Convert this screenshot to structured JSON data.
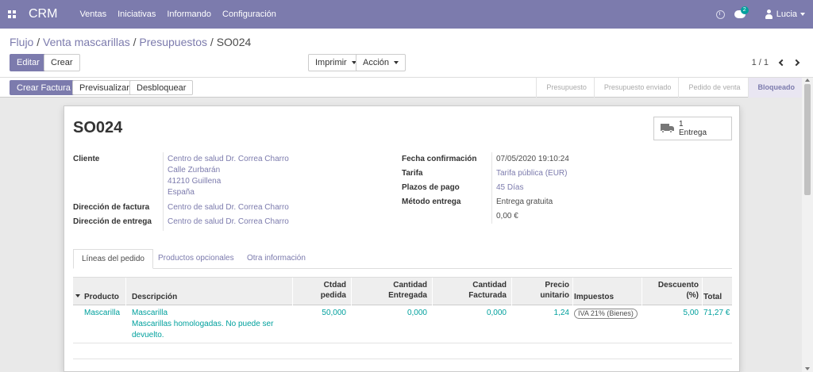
{
  "navbar": {
    "brand": "CRM",
    "menu": [
      "Ventas",
      "Iniciativas",
      "Informando",
      "Configuración"
    ],
    "chat_count": "2",
    "user": "Lucia"
  },
  "breadcrumb": {
    "parts": [
      "Flujo",
      "Venta mascarillas",
      "Presupuestos"
    ],
    "current": "SO024",
    "sep": " / "
  },
  "buttons": {
    "edit": "Editar",
    "create": "Crear",
    "print": "Imprimir",
    "action": "Acción",
    "create_invoice": "Crear Factura",
    "preview": "Previsualizar",
    "unlock": "Desbloquear"
  },
  "pager": {
    "value": "1 / 1"
  },
  "statusbar": {
    "steps": [
      "Presupuesto",
      "Presupuesto enviado",
      "Pedido de venta",
      "Bloqueado"
    ],
    "active": "Bloqueado"
  },
  "record": {
    "name": "SO024",
    "delivery_count": "1",
    "delivery_label": "Entrega",
    "labels": {
      "customer": "Cliente",
      "invoice_address": "Dirección de factura",
      "delivery_address": "Dirección de entrega",
      "confirmation_date": "Fecha confirmación",
      "pricelist": "Tarifa",
      "payment_terms": "Plazos de pago",
      "delivery_method": "Método entrega"
    },
    "customer": {
      "name": "Centro de salud Dr. Correa Charro",
      "street": "Calle Zurbarán",
      "city": "41210 Guillena",
      "country": "España"
    },
    "invoice_address": "Centro de salud Dr. Correa Charro",
    "delivery_address": "Centro de salud Dr. Correa Charro",
    "confirmation_date": "07/05/2020 19:10:24",
    "pricelist": "Tarifa pública (EUR)",
    "payment_terms": "45 Días",
    "delivery_method": "Entrega gratuita",
    "delivery_price": "0,00 €"
  },
  "tabs": [
    "Líneas del pedido",
    "Productos opcionales",
    "Otra información"
  ],
  "lines": {
    "headers": {
      "product": "Producto",
      "description": "Descripción",
      "qty_ordered_1": "Ctdad",
      "qty_ordered_2": "pedida",
      "qty_delivered_1": "Cantidad",
      "qty_delivered_2": "Entregada",
      "qty_invoiced_1": "Cantidad",
      "qty_invoiced_2": "Facturada",
      "price_1": "Precio",
      "price_2": "unitario",
      "taxes": "Impuestos",
      "discount_1": "Descuento",
      "discount_2": "(%)",
      "total": "Total"
    },
    "rows": [
      {
        "product": "Mascarilla",
        "desc_1": "Mascarilla",
        "desc_2": "Mascarillas homologadas. No puede ser",
        "desc_3": "devuelto.",
        "qty_ordered": "50,000",
        "qty_delivered": "0,000",
        "qty_invoiced": "0,000",
        "price": "1,24",
        "tax": "IVA 21% (Bienes)",
        "discount": "5,00",
        "total": "71,27 €"
      }
    ]
  }
}
